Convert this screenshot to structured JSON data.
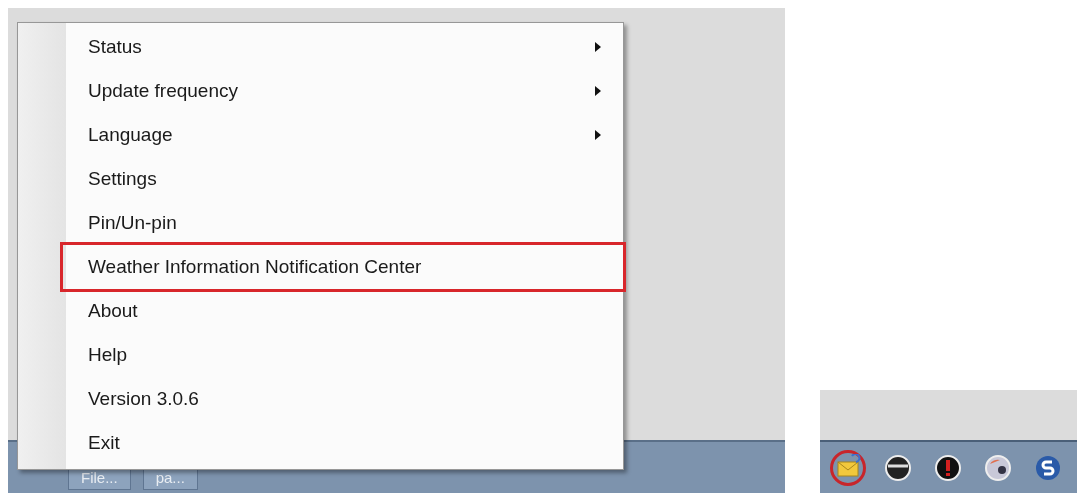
{
  "context_menu": {
    "items": [
      {
        "label": "Status",
        "submenu": true,
        "highlighted": false
      },
      {
        "label": "Update frequency",
        "submenu": true,
        "highlighted": false
      },
      {
        "label": "Language",
        "submenu": true,
        "highlighted": false
      },
      {
        "label": "Settings",
        "submenu": false,
        "highlighted": false
      },
      {
        "label": "Pin/Un-pin",
        "submenu": false,
        "highlighted": false
      },
      {
        "label": "Weather Information Notification Center",
        "submenu": false,
        "highlighted": true
      },
      {
        "label": "About",
        "submenu": false,
        "highlighted": false
      },
      {
        "label": "Help",
        "submenu": false,
        "highlighted": false
      },
      {
        "label": "Version 3.0.6",
        "submenu": false,
        "highlighted": false
      },
      {
        "label": "Exit",
        "submenu": false,
        "highlighted": false
      }
    ]
  },
  "taskbar": {
    "buttons": [
      {
        "label": "File..."
      },
      {
        "label": "pa..."
      }
    ]
  },
  "tray_inset": {
    "icons": [
      {
        "kind": "mail",
        "circled": true
      },
      {
        "kind": "disc",
        "circled": false
      },
      {
        "kind": "alert",
        "circled": false
      },
      {
        "kind": "globe",
        "circled": false
      },
      {
        "kind": "sync",
        "circled": false
      }
    ]
  }
}
